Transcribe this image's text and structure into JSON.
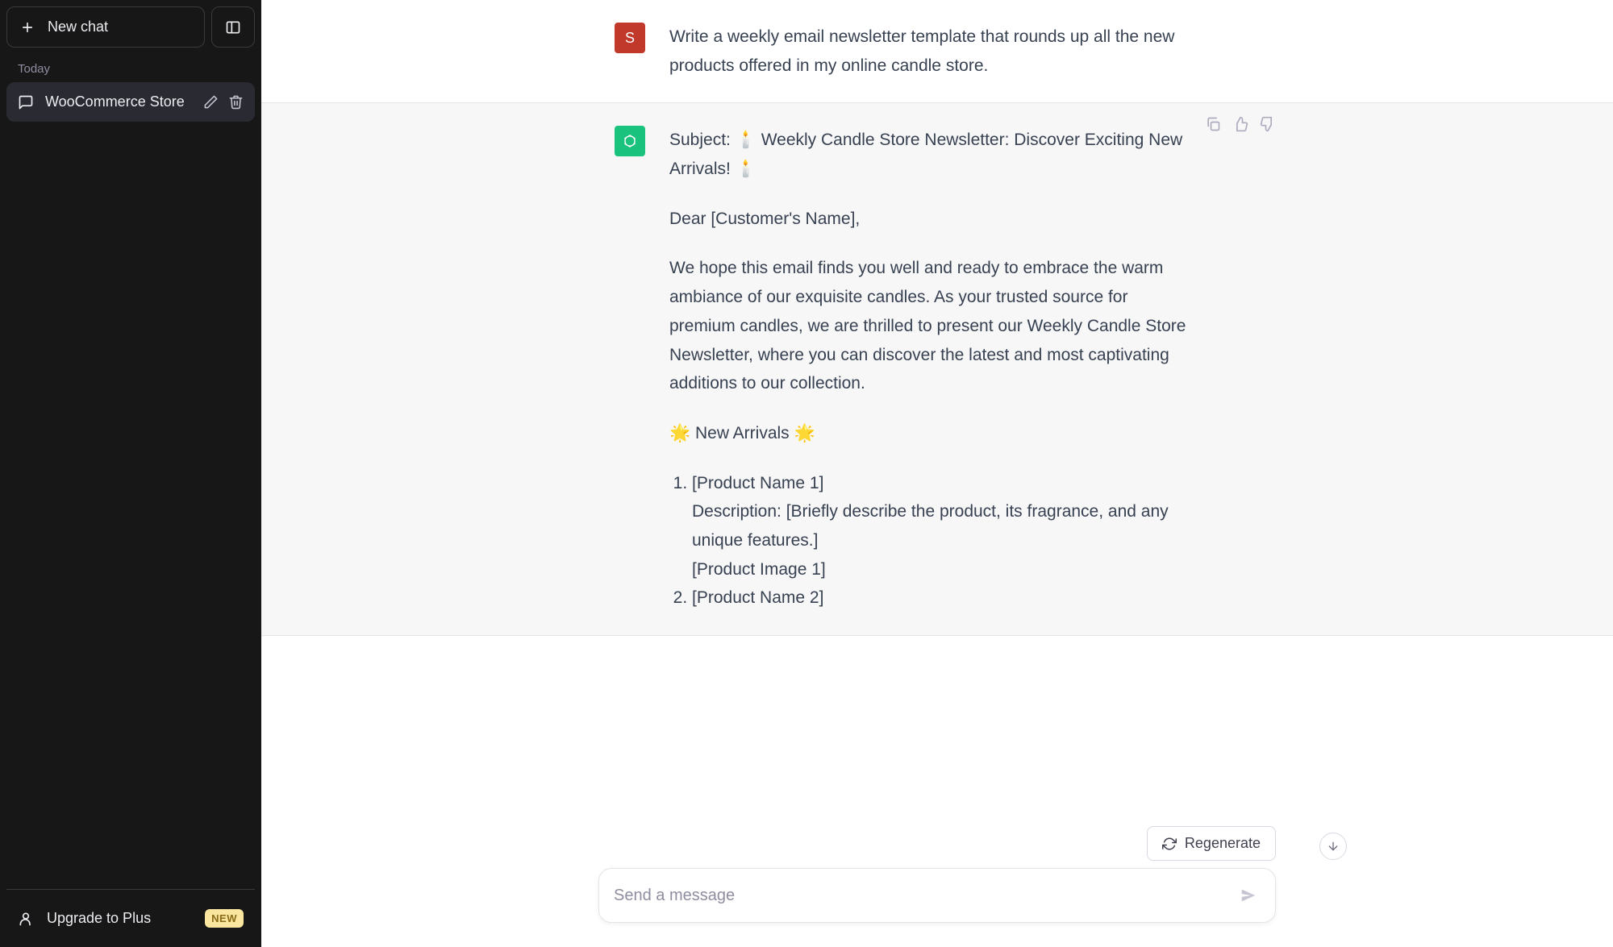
{
  "sidebar": {
    "new_chat_label": "New chat",
    "section_today": "Today",
    "active_chat_title": "WooCommerce Store",
    "upgrade_label": "Upgrade to Plus",
    "upgrade_badge": "NEW"
  },
  "conversation": {
    "user": {
      "avatar_letter": "S",
      "text": "Write a weekly email newsletter template that rounds up all the new products offered in my online candle store."
    },
    "assistant": {
      "subject": "Subject: 🕯️ Weekly Candle Store Newsletter: Discover Exciting New Arrivals! 🕯️",
      "greeting": "Dear [Customer's Name],",
      "intro": "We hope this email finds you well and ready to embrace the warm ambiance of our exquisite candles. As your trusted source for premium candles, we are thrilled to present our Weekly Candle Store Newsletter, where you can discover the latest and most captivating additions to our collection.",
      "section_heading": "🌟 New Arrivals 🌟",
      "items": [
        {
          "name": "[Product Name 1]",
          "desc": "Description: [Briefly describe the product, its fragrance, and any unique features.]",
          "image": "[Product Image 1]"
        },
        {
          "name": "[Product Name 2]"
        }
      ]
    }
  },
  "composer": {
    "regenerate_label": "Regenerate",
    "placeholder": "Send a message"
  },
  "colors": {
    "user_avatar": "#c0392b",
    "assistant_avatar": "#19c37d",
    "sidebar_bg": "#171717"
  }
}
